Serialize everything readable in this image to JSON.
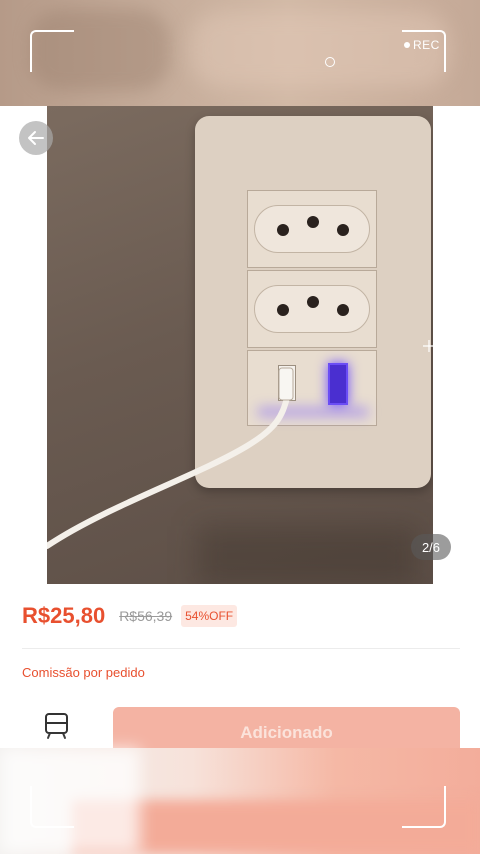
{
  "camera": {
    "rec_label": "REC"
  },
  "product": {
    "image_counter": "2/6",
    "price": "R$25,80",
    "original_price": "R$56,39",
    "discount_badge": "54%OFF",
    "commission_label": "Comissão por pedido"
  },
  "actions": {
    "add_button_label": "Adicionado",
    "cart_icon": "cart-icon"
  },
  "icons": {
    "back": "arrow-left-icon",
    "crosshair": "plus-icon"
  },
  "colors": {
    "accent": "#e8502f",
    "button_bg": "#f4b3a3"
  }
}
